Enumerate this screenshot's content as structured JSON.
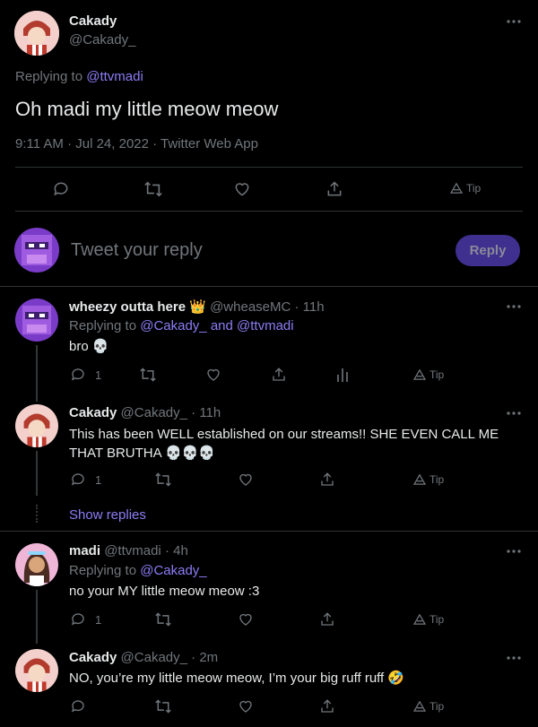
{
  "main_tweet": {
    "display_name": "Cakady",
    "handle": "@Cakady_",
    "replying_prefix": "Replying to",
    "replying_to": "@ttvmadi",
    "text": "Oh madi my little meow meow",
    "meta": "9:11 AM · Jul 24, 2022 · Twitter Web App",
    "actions": {
      "tip": "Tip"
    }
  },
  "composer": {
    "placeholder": "Tweet your reply",
    "reply_label": "Reply"
  },
  "replies": [
    {
      "display_name": "wheezy outta here",
      "badge": "👑",
      "handle": "@wheaseMC",
      "time": "· 11h",
      "replying_prefix": "Replying to",
      "replying_to_1": "@Cakady_",
      "replying_and": "and",
      "replying_to_2": "@ttvmadi",
      "text": "bro 💀",
      "reply_count": "1",
      "tip": "Tip"
    },
    {
      "display_name": "Cakady",
      "handle": "@Cakady_",
      "time": "· 11h",
      "text_line1": "This has been WELL established on our streams!! SHE EVEN CALL ME",
      "text_line2": "THAT BRUTHA 💀💀💀",
      "reply_count": "1",
      "tip": "Tip",
      "show_replies": "Show replies"
    },
    {
      "display_name": "madi",
      "handle": "@ttvmadi",
      "time": "· 4h",
      "replying_prefix": "Replying to",
      "replying_to": "@Cakady_",
      "text": "no your MY little meow meow :3",
      "reply_count": "1",
      "tip": "Tip"
    },
    {
      "display_name": "Cakady",
      "handle": "@Cakady_",
      "time": "· 2m",
      "text": "NO, you’re my little meow meow, I’m your big ruff ruff 🤣",
      "tip": "Tip"
    }
  ],
  "colors": {
    "background": "#000000",
    "text": "#e7e9ea",
    "muted": "#71767b",
    "link": "#8b7df5",
    "divider": "#2f3336",
    "reply_button": "#3f2f8e"
  },
  "icons": [
    "more-icon",
    "reply-icon",
    "retweet-icon",
    "like-icon",
    "share-icon",
    "analytics-icon",
    "tip-icon"
  ]
}
